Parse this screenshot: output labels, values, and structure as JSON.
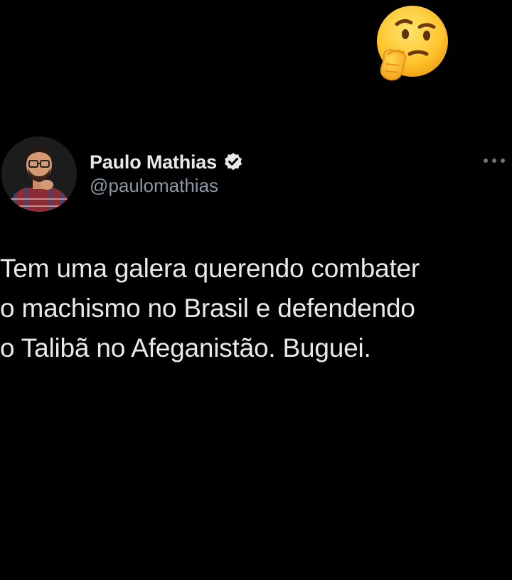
{
  "reaction": {
    "emoji_icon": "thinking-face-icon"
  },
  "tweet": {
    "author": {
      "display_name": "Paulo Mathias",
      "handle": "@paulomathias",
      "verified": true,
      "avatar_icon": "avatar"
    },
    "text": "Tem uma galera querendo combater\no machismo no Brasil e defendendo\no Talibã no Afeganistão. Buguei.",
    "more_icon": "more-horizontal-icon"
  },
  "colors": {
    "background": "#000000",
    "text_primary": "#e7e9ea",
    "text_secondary": "#8b98a5",
    "verified_badge": "#e7e9ea"
  }
}
